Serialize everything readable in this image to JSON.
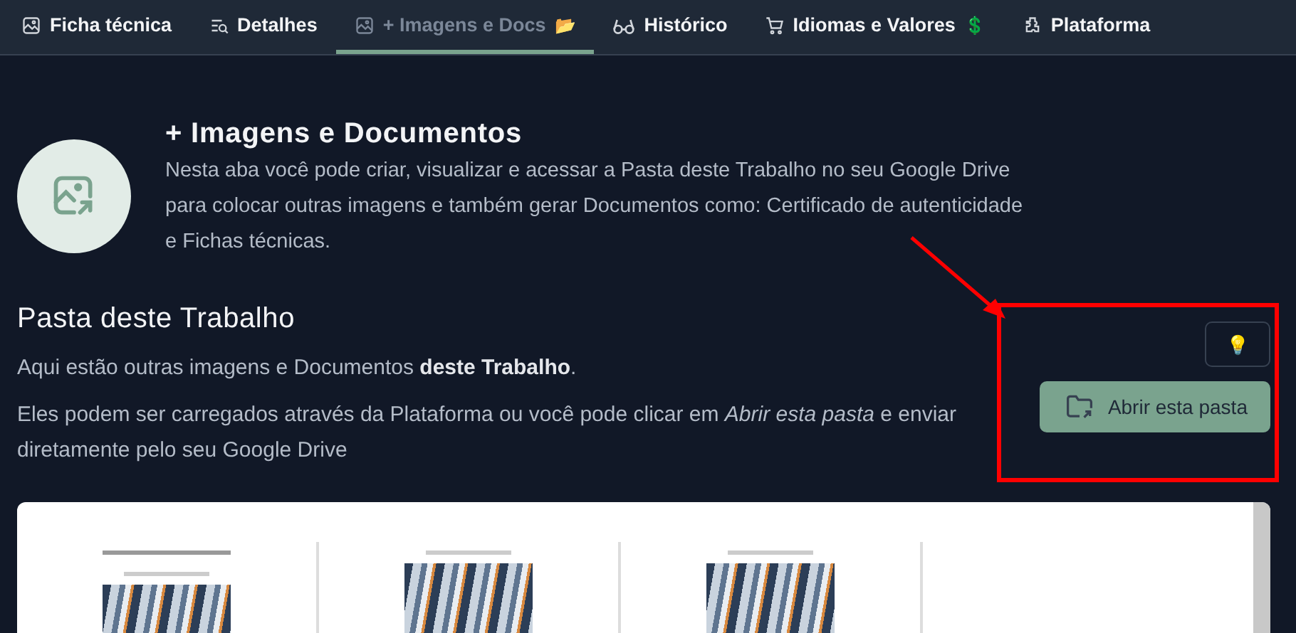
{
  "tabs": [
    {
      "label": "Ficha técnica",
      "kind": "image",
      "selected": false
    },
    {
      "label": "Detalhes",
      "kind": "list",
      "selected": false
    },
    {
      "label": "+ Imagens e Docs",
      "kind": "image",
      "suffix": "📂",
      "selected": true
    },
    {
      "label": "Histórico",
      "kind": "glasses",
      "selected": false
    },
    {
      "label": "Idiomas e Valores",
      "kind": "cart",
      "suffix": "💲",
      "selected": false
    },
    {
      "label": "Plataforma",
      "kind": "puzzle",
      "selected": false
    }
  ],
  "header": {
    "title": "+ Imagens e Documentos",
    "description": "Nesta aba você pode criar, visualizar e acessar a Pasta deste Trabalho no seu Google Drive para colocar outras imagens e também gerar Documentos como: Certificado de autenticidade e Fichas técnicas."
  },
  "folder_section": {
    "title": "Pasta deste Trabalho",
    "line_1": "Aqui estão outras imagens e Documentos **deste Trabalho**.",
    "line_2": "Eles podem ser carregados através da Plataforma ou você pode clicar em *Abrir esta pasta* e enviar diretamente pelo seu Google Drive",
    "hint_button": "💡",
    "open_button": "Abrir esta pasta"
  },
  "documents": [
    {
      "kind": "certificate"
    },
    {
      "kind": "sheet"
    },
    {
      "kind": "sheet"
    }
  ]
}
